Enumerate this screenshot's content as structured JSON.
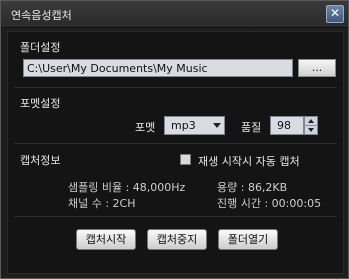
{
  "window": {
    "title": "연속음성캡처",
    "close_icon": "close-icon"
  },
  "folder": {
    "section_label": "폴더설정",
    "path_value": "C:\\User\\My Documents\\My Music",
    "browse_label": "..."
  },
  "format": {
    "section_label": "포멧설정",
    "format_label": "포멧",
    "format_value": "mp3",
    "quality_label": "품질",
    "quality_value": "98"
  },
  "capture": {
    "section_label": "캡처정보",
    "auto_capture_label": "재생 시작시 자동 캡처",
    "auto_capture_checked": false,
    "sampling_rate": "샘플링 비율 : 48,000Hz",
    "channels": "채널 수 : 2CH",
    "size": "용량 : 86,2KB",
    "elapsed": "진행 시간 : 00:00:05"
  },
  "buttons": {
    "start": "캡처시작",
    "stop": "캡처중지",
    "open_folder": "폴더열기"
  }
}
